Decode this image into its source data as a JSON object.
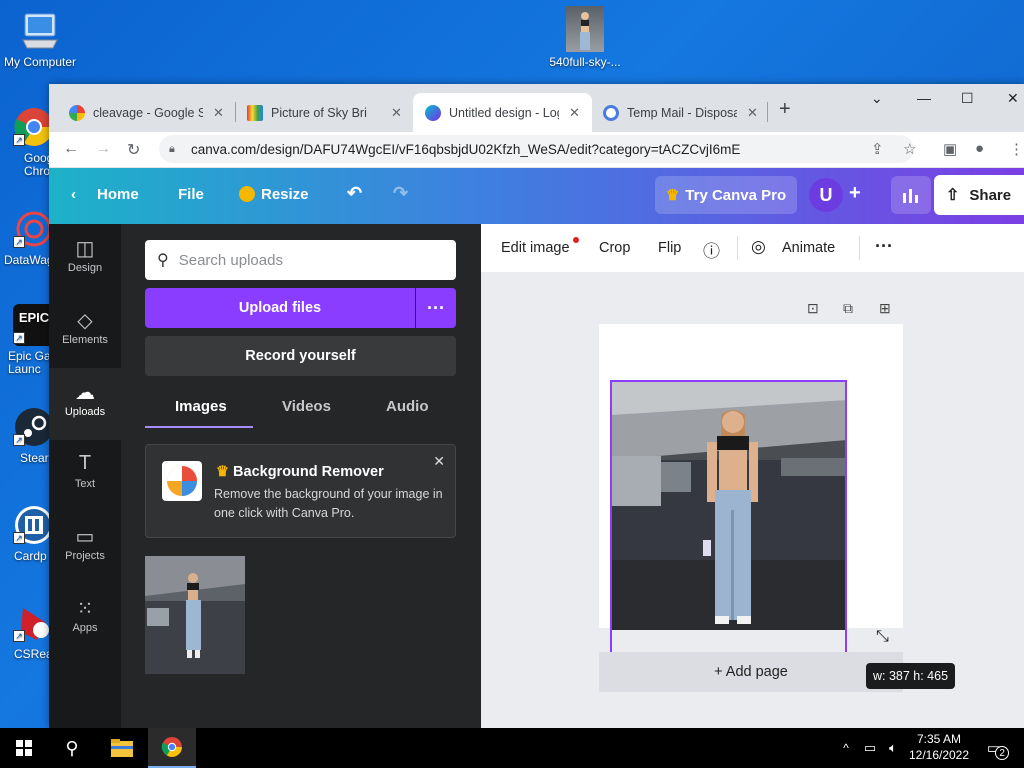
{
  "desktop": {
    "icons": [
      {
        "label": "My Computer"
      },
      {
        "label": "Goog Chror"
      },
      {
        "label": "DataWag"
      },
      {
        "label": "Epic Ga Launc"
      },
      {
        "label": "Stear"
      },
      {
        "label": "Cardp"
      },
      {
        "label": "CSRea"
      }
    ],
    "file_icon": {
      "label": "540full-sky-..."
    }
  },
  "browser": {
    "tabs": [
      {
        "title": "cleavage - Google Se",
        "active": false
      },
      {
        "title": "Picture of Sky Bri",
        "active": false
      },
      {
        "title": "Untitled design - Log",
        "active": true
      },
      {
        "title": "Temp Mail - Disposal",
        "active": false
      }
    ],
    "new_tab": "+",
    "url": "canva.com/design/DAFU74WgcEI/vF16qbsbjdU02Kfzh_WeSA/edit?category=tACZCvjI6mE"
  },
  "canva": {
    "header": {
      "home": "Home",
      "file": "File",
      "resize": "Resize",
      "try_pro": "Try Canva Pro",
      "avatar": "U",
      "share": "Share"
    },
    "rail": [
      {
        "label": "Design",
        "icon": "design-icon",
        "active": false
      },
      {
        "label": "Elements",
        "icon": "elements-icon",
        "active": false
      },
      {
        "label": "Uploads",
        "icon": "uploads-icon",
        "active": true
      },
      {
        "label": "Text",
        "icon": "text-icon",
        "active": false
      },
      {
        "label": "Projects",
        "icon": "projects-icon",
        "active": false
      },
      {
        "label": "Apps",
        "icon": "apps-icon",
        "active": false
      }
    ],
    "panel": {
      "search_placeholder": "Search uploads",
      "upload_files": "Upload files",
      "record_yourself": "Record yourself",
      "tabs": [
        {
          "label": "Images",
          "active": true
        },
        {
          "label": "Videos",
          "active": false
        },
        {
          "label": "Audio",
          "active": false
        }
      ],
      "promo": {
        "title": "Background Remover",
        "description": "Remove the background of your image in one click with Canva Pro."
      }
    },
    "context_bar": {
      "edit_image": "Edit image",
      "crop": "Crop",
      "flip": "Flip",
      "animate": "Animate"
    },
    "canvas": {
      "add_page": "+ Add page",
      "dimensions": "w: 387 h: 465"
    },
    "colors": {
      "accent_purple": "#8b3dff",
      "panel_bg": "#252627",
      "rail_bg": "#18191b"
    }
  },
  "taskbar": {
    "time": "7:35 AM",
    "date": "12/16/2022",
    "notifications": "2"
  }
}
